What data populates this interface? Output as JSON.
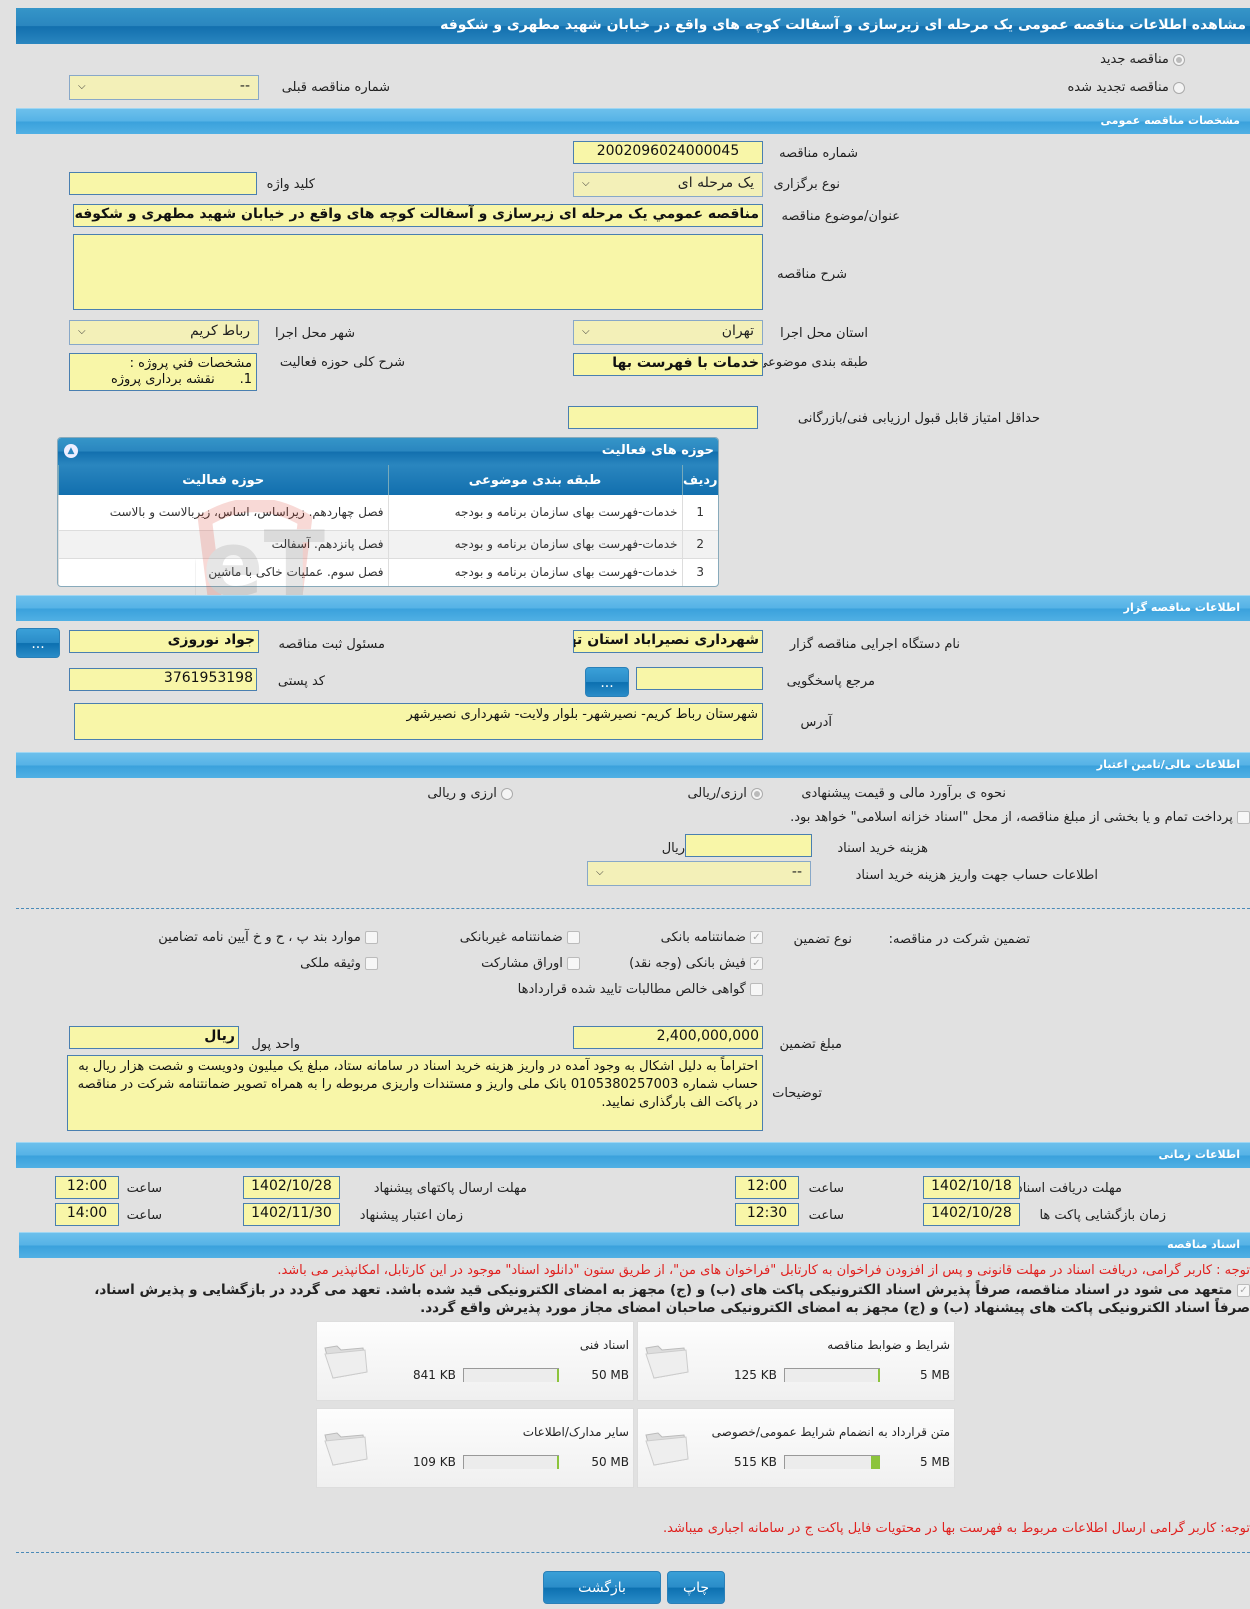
{
  "title": "مشاهده اطلاعات مناقصه عمومی یک مرحله ای زیرسازی و آسفالت کوچه های واقع در خیابان شهید مطهری و شکوفه",
  "tender_type_radios": {
    "new": "مناقصه جدید",
    "renewed": "مناقصه تجدید شده"
  },
  "previous_tender": {
    "label": "شماره مناقصه قبلی",
    "value": "--"
  },
  "general": {
    "section_title": "مشخصات مناقصه عمومی",
    "number_label": "شماره مناقصه",
    "number": "2002096024000045",
    "type_label": "نوع برگزاری",
    "type": "یک مرحله ای",
    "keyword_label": "کلید واژه",
    "keyword": "",
    "subject_label": "عنوان/موضوع مناقصه",
    "subject": "مناقصه عمومي يک مرحله ای زيرسازی و آسفالت کوچه های واقع در خيابان شهيد مطهری و شکوفه",
    "description_label": "شرح مناقصه",
    "description": "",
    "province_label": "استان محل اجرا",
    "province": "تهران",
    "city_label": "شهر محل اجرا",
    "city": "رباط کریم",
    "category_label": "طبقه بندی موضوعی",
    "category": "خدمات با فهرست بها",
    "activity_desc_label": "شرح کلی حوزه فعالیت",
    "activity_desc_line1": "مشخصات فني پروژه :",
    "activity_desc_line2": "1.      نقشه برداری پروژه",
    "min_score_label": "حداقل امتیاز قابل قبول ارزیابی فنی/بازرگانی",
    "min_score": ""
  },
  "activity_grid": {
    "title": "حوزه های فعالیت",
    "columns": [
      "ردیف",
      "طبقه بندی موضوعی",
      "حوزه فعالیت"
    ],
    "rows": [
      {
        "index": "1",
        "category": "خدمات-فهرست بهای سازمان برنامه و بودجه",
        "field": "فصل چهاردهم. زیراساس، اساس، زیربالاست  و بالاست"
      },
      {
        "index": "2",
        "category": "خدمات-فهرست بهای سازمان برنامه و بودجه",
        "field": "فصل پانزدهم. آسفالت"
      },
      {
        "index": "3",
        "category": "خدمات-فهرست بهای سازمان برنامه و بودجه",
        "field": "فصل سوم. عملیات خاکی با ماشین"
      }
    ]
  },
  "organizer": {
    "section_title": "اطلاعات مناقصه گزار",
    "org_label": "نام دستگاه اجرایی مناقصه گزار",
    "org": "شهرداری نصیراباد استان تهران",
    "responsible_label": "مسئول ثبت مناقصه",
    "responsible": "جواد نوروزی",
    "reference_label": "مرجع پاسخگویی",
    "reference": "",
    "postal_label": "کد پستی",
    "postal": "3761953198",
    "address_label": "آدرس",
    "address": "شهرستان رباط کریم- نصیرشهر- بلوار ولایت- شهرداری نصیرشهر",
    "browse": "..."
  },
  "finance": {
    "section_title": "اطلاعات مالی/تامین اعتبار",
    "estimate_label": "نحوه ی برآورد مالی و قیمت پیشنهادی",
    "opt_rial": "ارزی/ریالی",
    "opt_both": "ارزی و ریالی",
    "treasury_text": "پرداخت تمام و یا بخشی از مبلغ مناقصه، از محل \"اسناد خزانه اسلامی\" خواهد بود.",
    "doc_fee_label": "هزینه خرید اسناد",
    "doc_fee": "",
    "doc_fee_unit": "ریال",
    "account_label": "اطلاعات حساب جهت واریز هزینه خرید اسناد",
    "account": "--"
  },
  "guarantee": {
    "label": "تضمین شرکت در مناقصه:",
    "type_label": "نوع تضمین",
    "options": [
      {
        "label": "ضمانتنامه بانکی",
        "checked": true
      },
      {
        "label": "ضمانتنامه غیربانکی",
        "checked": false
      },
      {
        "label": "موارد بند پ ، ح و خ آیین نامه تضامین",
        "checked": false
      },
      {
        "label": "فیش بانکی (وجه نقد)",
        "checked": true
      },
      {
        "label": "اوراق مشارکت",
        "checked": false
      },
      {
        "label": "وثیقه ملکی",
        "checked": false
      },
      {
        "label": "گواهی خالص مطالبات تایید شده قراردادها",
        "checked": false
      }
    ],
    "amount_label": "مبلغ تضمین",
    "amount": "2,400,000,000",
    "currency_label": "واحد پول",
    "currency": "ریال",
    "notes_label": "توضیحات",
    "notes": "احتراماً به دليل اشکال به وجود آمده در واريز هزينه خريد اسناد در سامانه ستاد، مبلغ يک ميليون ودويست و شصت هزار ريال به حساب شماره 0105380257003 بانک ملی واريز و مستندات واريزی مربوطه را به همراه تصوير ضمانتنامه شرکت در مناقصه در پاکت الف بارگذاری نماييد."
  },
  "timing": {
    "section_title": "اطلاعات زمانی",
    "time_label": "ساعت",
    "doc_receive_label": "مهلت دریافت اسناد",
    "doc_receive_date": "1402/10/18",
    "doc_receive_time": "12:00",
    "submit_label": "مهلت ارسال پاکتهای پیشنهاد",
    "submit_date": "1402/10/28",
    "submit_time": "12:00",
    "opening_label": "زمان بازگشایی پاکت ها",
    "opening_date": "1402/10/28",
    "opening_time": "12:30",
    "validity_label": "زمان اعتبار پیشنهاد",
    "validity_date": "1402/11/30",
    "validity_time": "14:00"
  },
  "documents": {
    "section_title": "اسناد مناقصه",
    "notice": "توجه : کاربر گرامی، دریافت اسناد در مهلت قانونی و پس از افزودن فراخوان به کارتابل \"فراخوان های من\"، از طریق ستون \"دانلود اسناد\" موجود در این کارتابل، امکانپذیر می باشد.",
    "commit_line1": "متعهد می شود در اسناد مناقصه، صرفاً پذیرش اسناد الکترونیکی پاکت های (ب) و (ج) مجهز به امضای الکترونیکی قید شده باشد. تعهد می گردد در بازگشایی و پذیرش اسناد،",
    "commit_line2": "صرفاً اسناد الکترونیکی پاکت های پیشنهاد (ب) و (ج) مجهز به امضای الکترونیکی صاحبان امضای مجاز مورد پذیرش واقع گردد.",
    "items": [
      {
        "name": "شرایط و ضوابط مناقصه",
        "used": "125 KB",
        "max": "5 MB",
        "fill": 0.024
      },
      {
        "name": "اسناد فنی",
        "used": "841 KB",
        "max": "50 MB",
        "fill": 0.016
      },
      {
        "name": "متن قرارداد به انضمام شرایط عمومی/خصوصی",
        "used": "515 KB",
        "max": "5 MB",
        "fill": 0.1
      },
      {
        "name": "سایر مدارک/اطلاعات",
        "used": "109 KB",
        "max": "50 MB",
        "fill": 0.002
      }
    ],
    "footer_notice": "توجه: کاربر گرامی ارسال اطلاعات مربوط به فهرست بها در محتویات فایل پاکت ج در سامانه اجباری میباشد."
  },
  "actions": {
    "print": "چاپ",
    "back": "بازگشت"
  },
  "watermark": "AriaTender.neT"
}
